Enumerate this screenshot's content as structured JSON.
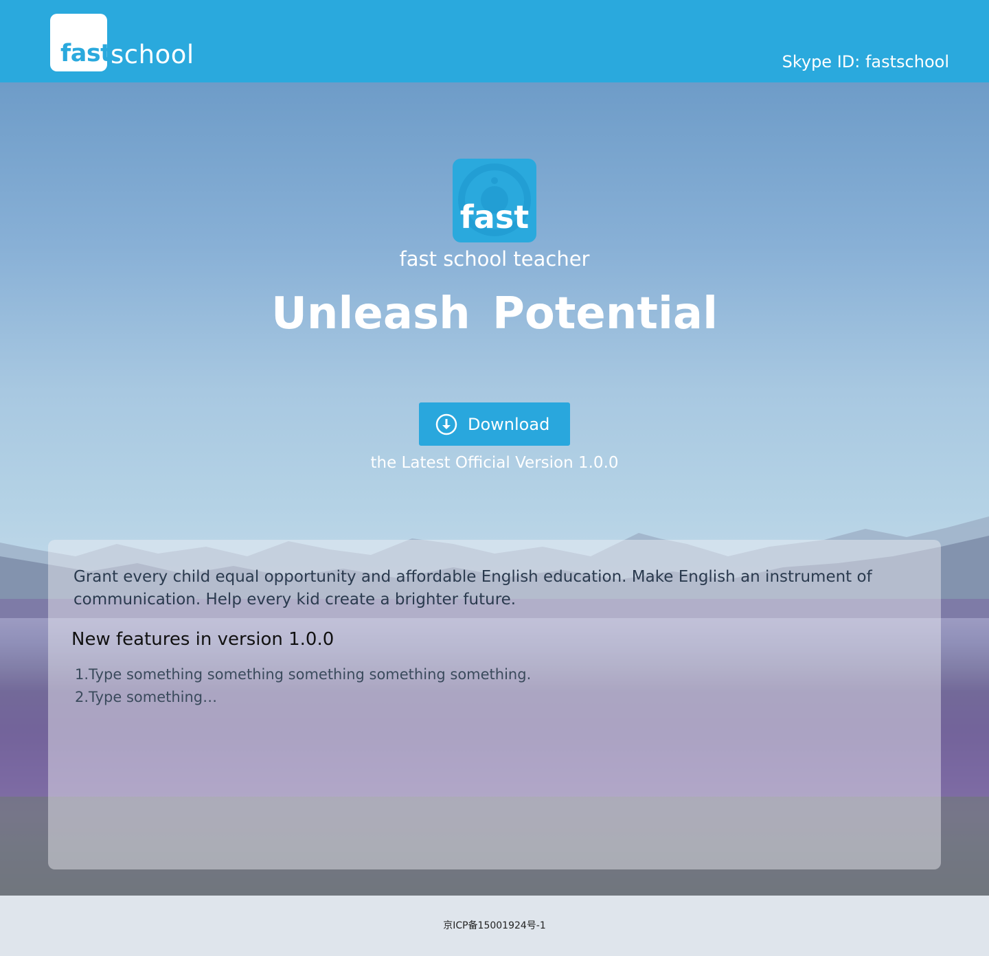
{
  "header": {
    "logo_fast": "fast",
    "logo_school": "school",
    "skype_id": "Skype ID: fastschool"
  },
  "hero": {
    "app_icon_text": "fast",
    "app_name": "fast school teacher",
    "tagline": "Unleash Potential",
    "download_label": "Download",
    "download_icon": "download-circle-icon",
    "version_line": "the Latest Official Version 1.0.0"
  },
  "info": {
    "mission": "Grant every child equal opportunity and affordable English education. Make English an instrument of communication. Help every kid create a brighter future.",
    "features_title": "New features in version 1.0.0",
    "features": [
      "1.Type something something something something something.",
      "2.Type something…"
    ]
  },
  "footer": {
    "icp": "京ICP备15001924号-1"
  },
  "colors": {
    "brand_blue": "#2aa9dd",
    "footer_bg": "#dfe5ec"
  }
}
